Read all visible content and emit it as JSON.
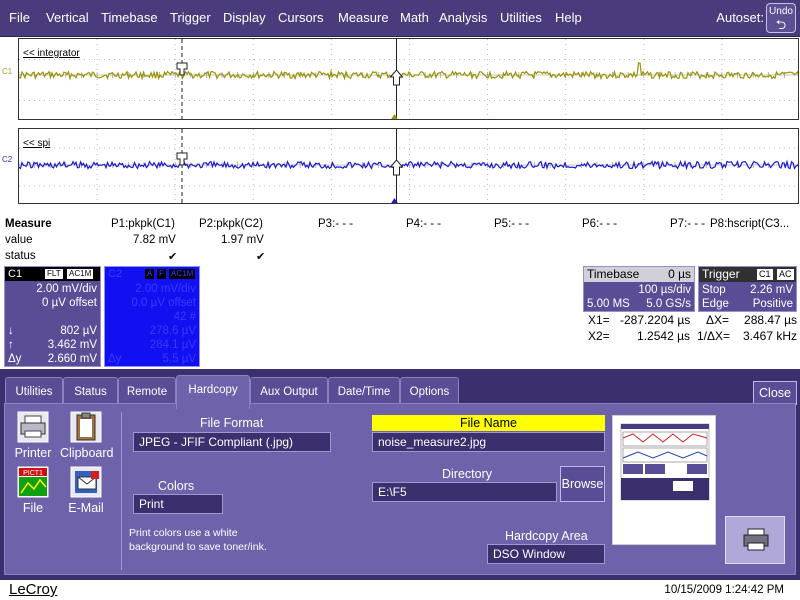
{
  "menu": {
    "items": [
      "File",
      "Vertical",
      "Timebase",
      "Trigger",
      "Display",
      "Cursors",
      "Measure",
      "Math",
      "Analysis",
      "Utilities",
      "Help"
    ],
    "autoset_label": "Autoset:",
    "undo_label": "Undo"
  },
  "traces": {
    "trace1_title": "<< integrator",
    "trace1_side": "C1",
    "trace2_title": "<< spi",
    "trace2_side": "C2"
  },
  "measure": {
    "header": "Measure",
    "row_labels": [
      "value",
      "status"
    ],
    "params": [
      {
        "name": "P1:pkpk(C1)",
        "value": "7.82 mV",
        "status": "✔"
      },
      {
        "name": "P2:pkpk(C2)",
        "value": "1.97 mV",
        "status": "✔"
      },
      {
        "name": "P3:- - -",
        "value": "",
        "status": ""
      },
      {
        "name": "P4:- - -",
        "value": "",
        "status": ""
      },
      {
        "name": "P5:- - -",
        "value": "",
        "status": ""
      },
      {
        "name": "P6:- - -",
        "value": "",
        "status": ""
      },
      {
        "name": "P7:- - -",
        "value": "",
        "status": ""
      },
      {
        "name": "P8:hscript(C3...",
        "value": "",
        "status": ""
      }
    ]
  },
  "channels": {
    "c1": {
      "label": "C1",
      "tags": [
        "FLT",
        "AC1M"
      ],
      "volts_div": "2.00 mV/div",
      "offset": "0 µV offset",
      "cursor_down": "802 µV",
      "cursor_up": "3.462 mV",
      "delta": "2.660 mV",
      "down_symbol": "↓",
      "up_symbol": "↑",
      "delta_symbol": "Δy"
    },
    "c2": {
      "label": "C2",
      "tags": [
        "A",
        "F",
        "AC1M"
      ],
      "volts_div": "2.00 mV/div",
      "offset": "0.0 µV offset",
      "count": "42 #",
      "v1": "278.6 µV",
      "v2": "284.1 µV",
      "v3": "5.5 µV",
      "delta_symbol": "Δy"
    }
  },
  "timebase": {
    "label": "Timebase",
    "delay": "0 µs",
    "time_div": "100 µs/div",
    "samples": "5.00 MS",
    "rate": "5.0 GS/s"
  },
  "trigger": {
    "label": "Trigger",
    "tags": [
      "C1",
      "AC"
    ],
    "mode": "Stop",
    "level": "2.26 mV",
    "type": "Edge",
    "slope": "Positive"
  },
  "cursors": {
    "x1_label": "X1=",
    "x1": "-287.2204 µs",
    "x2_label": "X2=",
    "x2": "1.2542 µs",
    "dx_label": "ΔX=",
    "dx": "288.47 µs",
    "inv_dx_label": "1/ΔX=",
    "inv_dx": "3.467 kHz"
  },
  "dialog": {
    "tabs": [
      "Utilities",
      "Status",
      "Remote",
      "Hardcopy",
      "Aux Output",
      "Date/Time",
      "Options"
    ],
    "active_tab": "Hardcopy",
    "close_label": "Close",
    "devices": [
      "Printer",
      "Clipboard",
      "File",
      "E-Mail"
    ],
    "file_icon_text": "PICT1",
    "file_format_label": "File Format",
    "file_format_value": "JPEG - JFIF Compliant (.jpg)",
    "colors_label": "Colors",
    "colors_value": "Print",
    "note": "Print colors use a white background to save toner/ink.",
    "file_name_label": "File Name",
    "file_name_value": "noise_measure2.jpg",
    "directory_label": "Directory",
    "directory_value": "E:\\F5",
    "browse_label": "Browse",
    "hardcopy_area_label": "Hardcopy Area",
    "hardcopy_area_value": "DSO Window"
  },
  "footer": {
    "brand": "LeCroy",
    "datetime": "10/15/2009 1:24:42 PM"
  },
  "colors": {
    "trace1": "#9a9300",
    "trace2": "#1a1ad0",
    "menubar": "#4a3c7c",
    "dialog": "#3b2f6e",
    "panel": "#6e62aa",
    "highlight": "#ffff00"
  }
}
